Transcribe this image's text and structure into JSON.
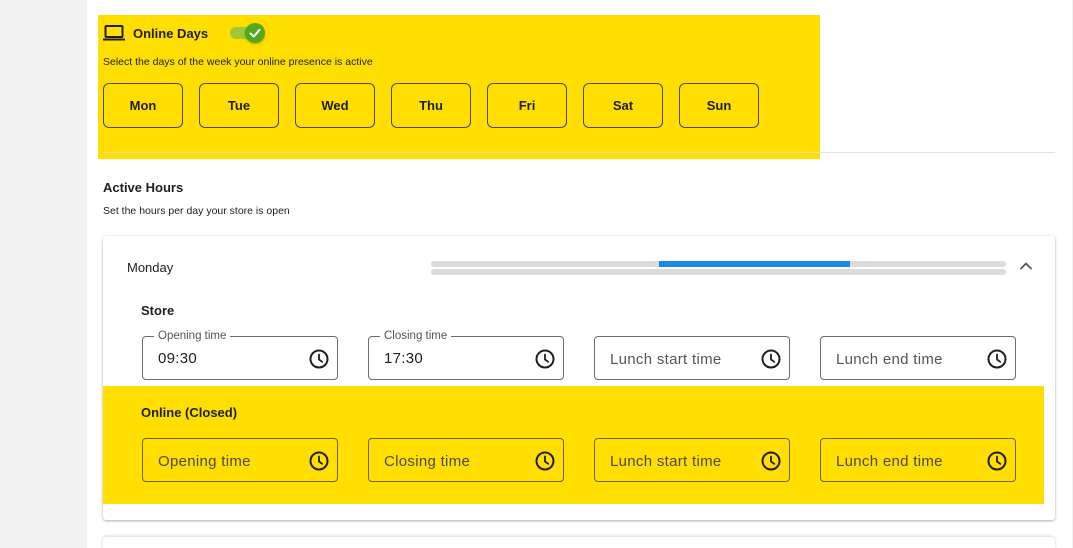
{
  "online_days": {
    "title": "Online Days",
    "description": "Select the days of the week your online presence is active",
    "toggle_on": true,
    "days": [
      "Mon",
      "Tue",
      "Wed",
      "Thu",
      "Fri",
      "Sat",
      "Sun"
    ]
  },
  "active_hours": {
    "title": "Active Hours",
    "description": "Set the hours per day your store is open"
  },
  "monday": {
    "day": "Monday",
    "progress": {
      "start_fraction": 0.396,
      "end_fraction": 0.729
    },
    "store": {
      "label": "Store",
      "opening": {
        "label": "Opening time",
        "value": "09:30"
      },
      "closing": {
        "label": "Closing time",
        "value": "17:30"
      },
      "lunch_start": {
        "placeholder": "Lunch start time"
      },
      "lunch_end": {
        "placeholder": "Lunch end time"
      }
    },
    "online": {
      "label": "Online (Closed)",
      "opening": {
        "placeholder": "Opening time"
      },
      "closing": {
        "placeholder": "Closing time"
      },
      "lunch_start": {
        "placeholder": "Lunch start time"
      },
      "lunch_end": {
        "placeholder": "Lunch end time"
      }
    }
  },
  "colors": {
    "highlight": "#ffde00",
    "toggle": "#53a81d",
    "progress": "#1e88e5"
  },
  "icons": {
    "online_days": "laptop-icon",
    "toggle_check": "check-icon",
    "expand": "chevron-up-icon",
    "time": "clock-icon"
  }
}
